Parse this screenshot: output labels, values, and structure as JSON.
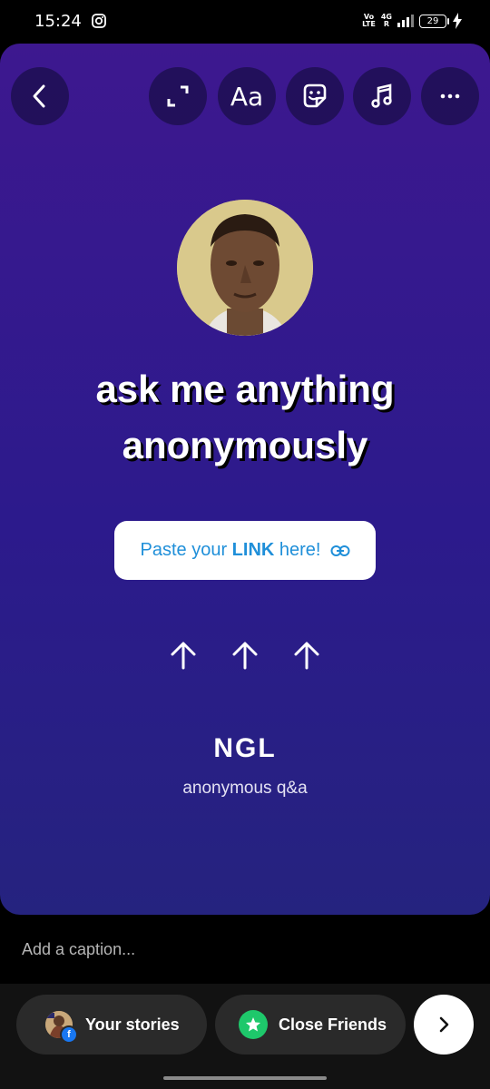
{
  "status": {
    "time": "15:24",
    "carrier_top": "Vo",
    "carrier_bottom": "LTE",
    "network_top": "4G",
    "network_bottom": "R",
    "battery": "29"
  },
  "toolbar": {
    "text_tool_label": "Aa"
  },
  "story": {
    "title_line1": "ask me anything",
    "title_line2": "anonymously",
    "link_prefix": "Paste your ",
    "link_bold": "LINK",
    "link_suffix": " here!",
    "brand": "NGL",
    "brand_sub": "anonymous q&a"
  },
  "caption": {
    "placeholder": "Add a caption..."
  },
  "share": {
    "your_stories": "Your stories",
    "close_friends": "Close Friends",
    "facebook_badge": "f"
  },
  "colors": {
    "canvas_top": "#3d188f",
    "canvas_bottom": "#25237f",
    "link_blue": "#1f8fd9",
    "close_friends_green": "#1ec86b"
  }
}
